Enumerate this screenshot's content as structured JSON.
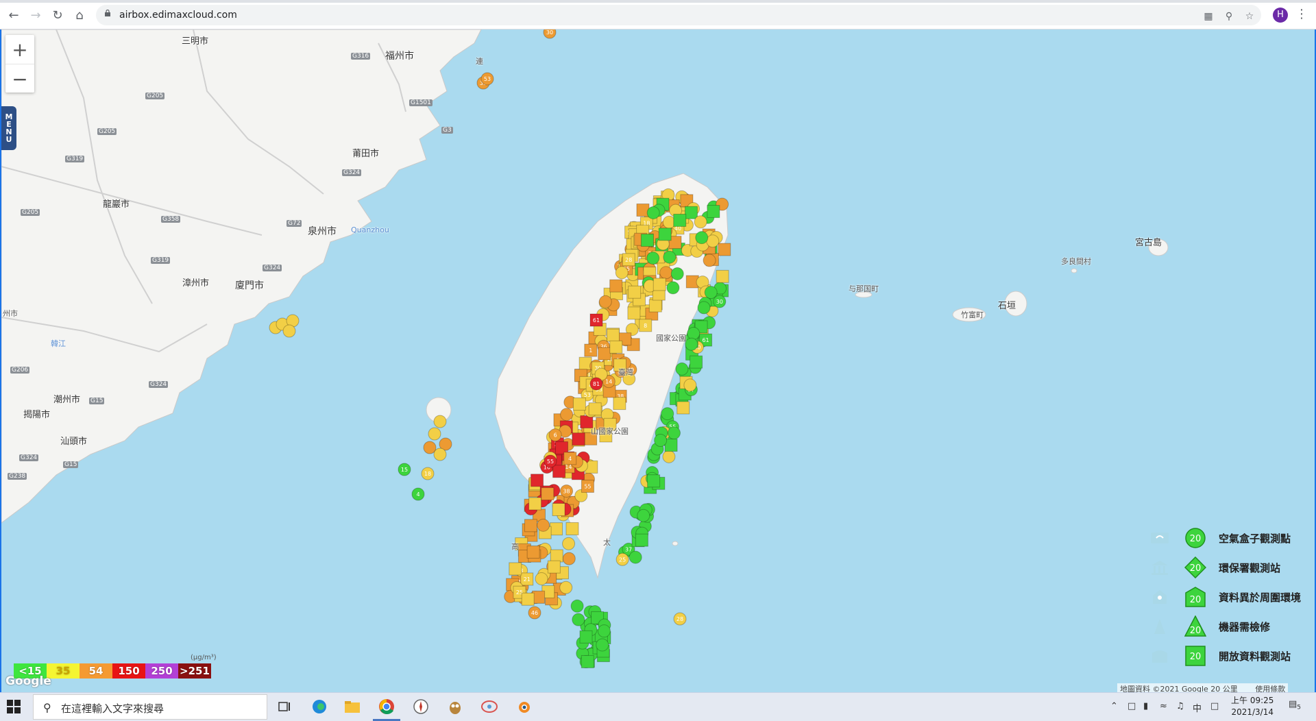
{
  "browser": {
    "url": "airbox.edimaxcloud.com",
    "avatar_letter": "H",
    "icons": [
      "back-icon",
      "forward-icon",
      "reload-icon",
      "home-icon",
      "lock-icon",
      "translate-icon",
      "zoom-icon",
      "star-icon",
      "kebab-icon"
    ]
  },
  "map": {
    "zoom_in": "+",
    "zoom_out": "−",
    "menu_label": [
      "M",
      "E",
      "N",
      "U"
    ],
    "places": {
      "sanming": "三明市",
      "fuzhou": "福州市",
      "putian": "莆田市",
      "longyan": "龍巖市",
      "quanzhou": "泉州市",
      "quanzhou_en": "Quanzhou",
      "zhangzhou": "漳州市",
      "xiamen": "廈門市",
      "chaozhou": "潮州市",
      "jieyang": "揭陽市",
      "shantou": "汕頭市",
      "meizhou_edge": "州市",
      "hanjiang": "韓江",
      "national_park_n": "國家公園",
      "national_park_c": "山國家公園",
      "taiwan": "臺灣",
      "taitung_char": "太",
      "kaohsiung_char": "高",
      "yonaguni": "与那国町",
      "taketomi": "竹富町",
      "ishigaki": "石垣",
      "tarama": "多良間村",
      "miyakojima": "宮古島",
      "lianjiang_char": "連"
    },
    "roads": [
      "G316",
      "G205",
      "G1501",
      "G3",
      "G205",
      "G319",
      "G324",
      "G358",
      "G72",
      "G205",
      "G319",
      "G324",
      "G206",
      "G324",
      "G15",
      "G324",
      "G15",
      "G238"
    ],
    "attribution": "地圖資料 ©2021 Google   20 公里",
    "terms": "使用條款",
    "google": "Google"
  },
  "legend": {
    "items": [
      {
        "label": "空氣盒子觀測點",
        "value": "20",
        "shape": "circle"
      },
      {
        "label": "環保署觀測站",
        "value": "20",
        "shape": "diamond"
      },
      {
        "label": "資料異於周圍環境",
        "value": "20",
        "shape": "house"
      },
      {
        "label": "機器需檢修",
        "value": "20",
        "shape": "triangle"
      },
      {
        "label": "開放資料觀測站",
        "value": "20",
        "shape": "square"
      }
    ],
    "icons": [
      "airbox-icon",
      "epa-station-icon",
      "anomaly-icon",
      "repair-icon",
      "open-data-icon"
    ]
  },
  "scale": {
    "unit": "(μg/m³)",
    "segments": [
      {
        "label": "<15",
        "color": "#3ee63e"
      },
      {
        "label": "35",
        "color": "#f5f532"
      },
      {
        "label": "54",
        "color": "#f59a32"
      },
      {
        "label": "150",
        "color": "#e81414"
      },
      {
        "label": "250",
        "color": "#b340d6"
      },
      {
        "label": ">251",
        "color": "#8a1010"
      }
    ]
  },
  "markers": {
    "labels": [
      "30",
      "53",
      "38",
      "21",
      "25",
      "15",
      "4",
      "18",
      "46",
      "37",
      "61",
      "81",
      "40",
      "55",
      "36",
      "6",
      "10",
      "14",
      "16",
      "8",
      "28",
      "1"
    ]
  },
  "colors": {
    "green": "#3dd43d",
    "yellow": "#f2cf46",
    "orange": "#ec9a32",
    "red": "#e0262c"
  },
  "taskbar": {
    "search_placeholder": "在這裡輸入文字來搜尋",
    "tray_ime": "中",
    "time": "上午 09:25",
    "date": "2021/3/14",
    "notifications": "5"
  }
}
